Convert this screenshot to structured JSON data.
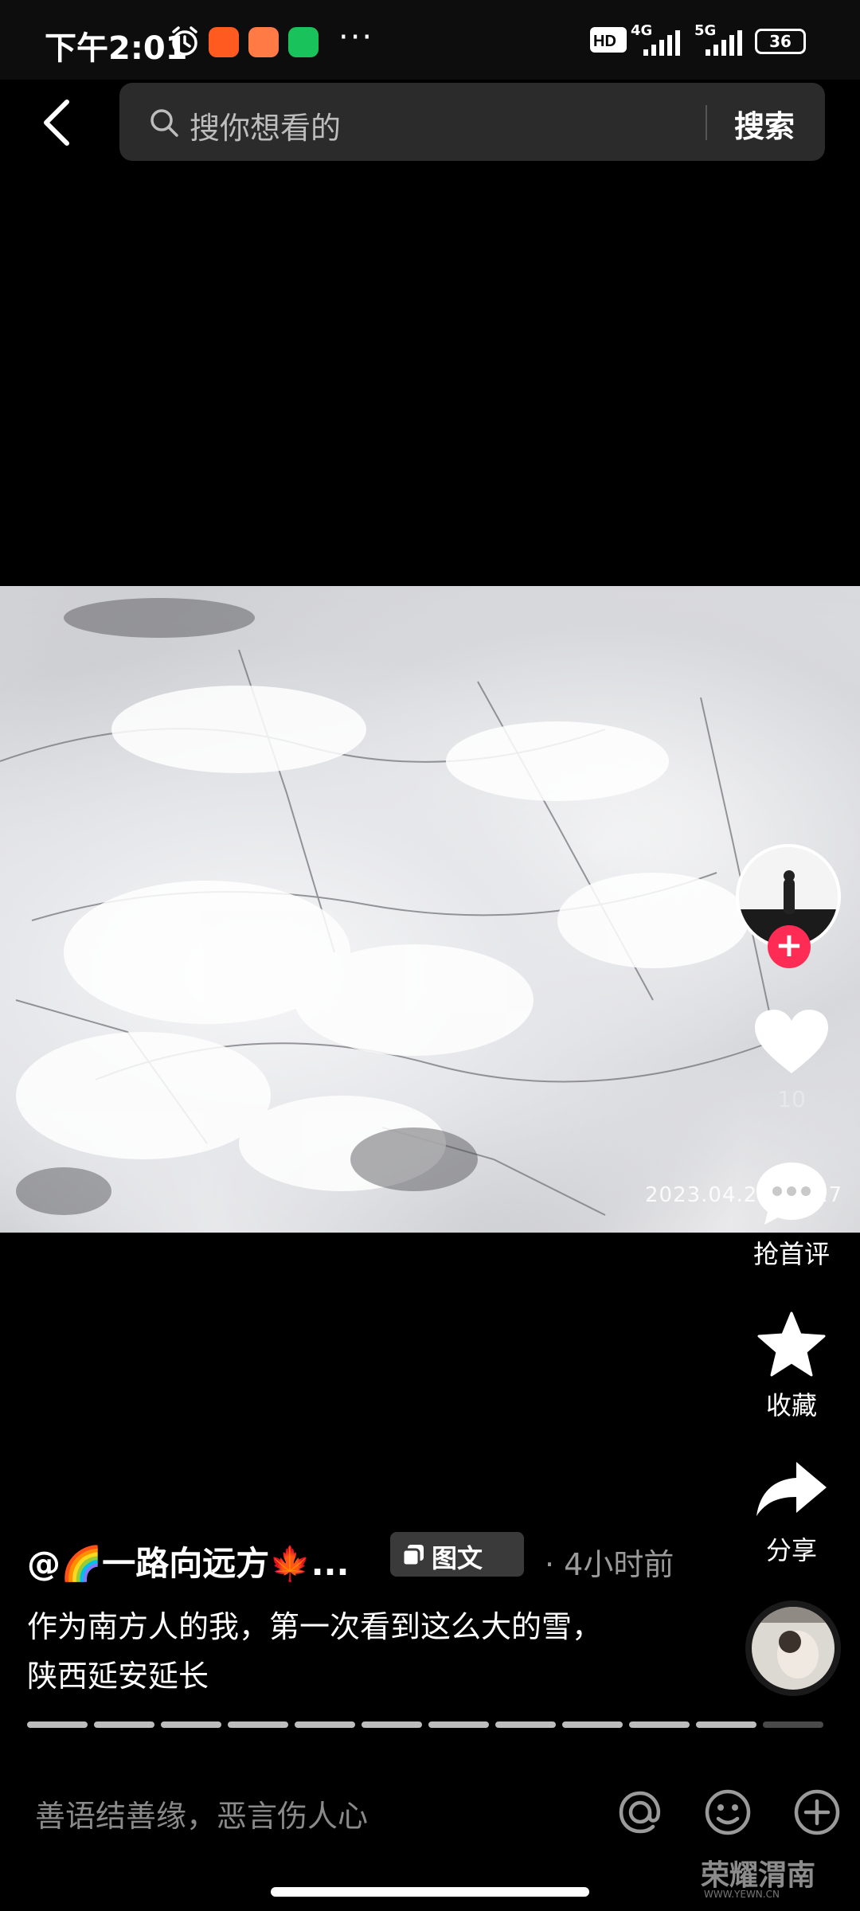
{
  "status_bar": {
    "time": "下午2:01",
    "dots": "···",
    "network_1": "4G",
    "network_2": "5G",
    "battery": "36"
  },
  "search": {
    "placeholder": "搜你想看的",
    "button_label": "搜索"
  },
  "post": {
    "timestamp_overlay": "2023.04.22 10:17",
    "author": "@🌈一路向远方🍁...",
    "type_badge": "图文",
    "time_ago": "· 4小时前",
    "caption_line_1": "作为南方人的我，第一次看到这么大的雪，",
    "caption_line_2": "陕西延安延长",
    "progress_total": 12,
    "progress_current": 12
  },
  "actions": {
    "follow_symbol": "+",
    "like_count": "10",
    "comment_label": "抢首评",
    "favorite_label": "收藏",
    "share_label": "分享"
  },
  "comment_bar": {
    "placeholder": "善语结善缘，恶言伤人心"
  },
  "watermark": {
    "title": "荣耀渭南",
    "subtitle": "WWW.YEWN.CN"
  },
  "colors": {
    "accent_pink": "#fe2c55",
    "background": "#000000",
    "search_bg": "#2b2b2b"
  }
}
